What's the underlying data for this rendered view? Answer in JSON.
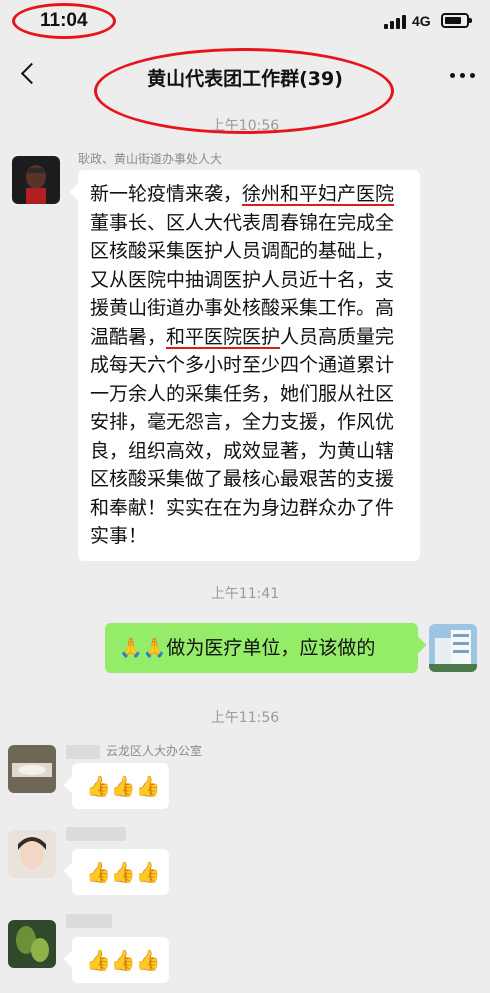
{
  "status_bar": {
    "time": "11:04",
    "network": "4G"
  },
  "nav": {
    "title": "黄山代表团工作群(39)"
  },
  "messages": {
    "ts1": "上午10:56",
    "m1_sender": "耿政、黄山街道办事处人大",
    "m1_text_a": "新一轮疫情来袭，",
    "m1_text_hl1": "徐州和平妇产医院",
    "m1_text_b": "董事长、区人大代表周春锦在完成全区核酸采集医护人员调配的基础上，又从医院中抽调医护人员近十名，支援黄山街道办事处核酸采集工作。高温酷暑，",
    "m1_text_hl2": "和平医院医护",
    "m1_text_c": "人员高质量完成每天六个多小时至少四个通道累计一万余人的采集任务，她们服从社区安排，毫无怨言，全力支援，作风优良，组织高效，成效显著，为黄山辖区核酸采集做了最核心最艰苦的支援和奉献！实实在在为身边群众办了件实事！",
    "ts2": "上午11:41",
    "m2_emoji": "🙏🙏",
    "m2_text": "做为医疗单位，应该做的",
    "ts3": "上午11:56",
    "m3_sender": "云龙区人大办公室",
    "thumbs": "👍👍👍"
  },
  "icons": {
    "back": "chevron-left-icon",
    "more": "more-dots-icon",
    "signal": "signal-icon",
    "battery": "battery-icon"
  },
  "colors": {
    "background": "#ededed",
    "my_bubble": "#95ec69",
    "their_bubble": "#ffffff",
    "annotation_red": "#e8141c"
  }
}
